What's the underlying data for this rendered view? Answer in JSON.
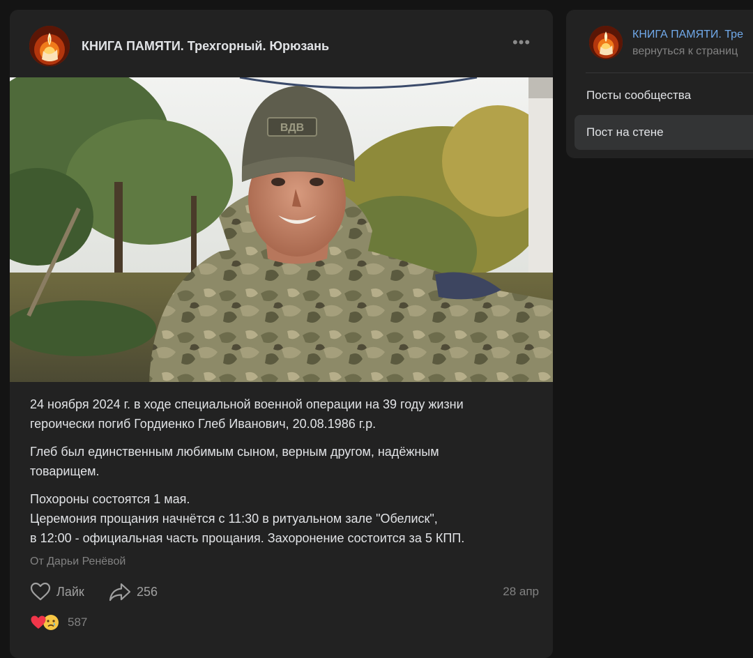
{
  "post": {
    "author": "КНИГА ПАМЯТИ. Трехгорный. Юрюзань",
    "more_label": "•••",
    "paragraphs": [
      "24 ноября 2024 г. в ходе специальной военной операции на 39 году жизни\nгероически погиб Гордиенко Глеб Иванович, 20.08.1986 г.р.",
      "Глеб был единственным любимым сыном, верным другом, надёжным\nтоварищем.",
      "Похороны состоятся 1 мая.\nЦеремония прощания начнётся с 11:30 в ритуальном зале \"Обелиск\",\nв 12:00 - официальная часть прощания. Захоронение состоится за 5 КПП."
    ],
    "signer": "От Дарьи Ренёвой",
    "like_label": "Лайк",
    "share_count": "256",
    "date": "28 апр",
    "reactions_count": "587",
    "hat_patch_text": "ВДВ"
  },
  "sidebar": {
    "title": "КНИГА ПАМЯТИ. Тре",
    "back_link": "вернуться к страниц",
    "items": [
      {
        "label": "Посты сообщества",
        "active": false
      },
      {
        "label": "Пост на стене",
        "active": true
      }
    ]
  },
  "icons": {
    "avatar": "memorial-candle-icon",
    "more": "ellipsis-icon",
    "like": "heart-outline-icon",
    "share": "share-arrow-icon",
    "reaction_1": "red-heart-emoji",
    "reaction_2": "crying-face-emoji"
  },
  "colors": {
    "background": "#141414",
    "card": "#222222",
    "text": "#e1e3e6",
    "muted": "#828282",
    "link": "#71aaeb",
    "active_item": "#333435"
  }
}
